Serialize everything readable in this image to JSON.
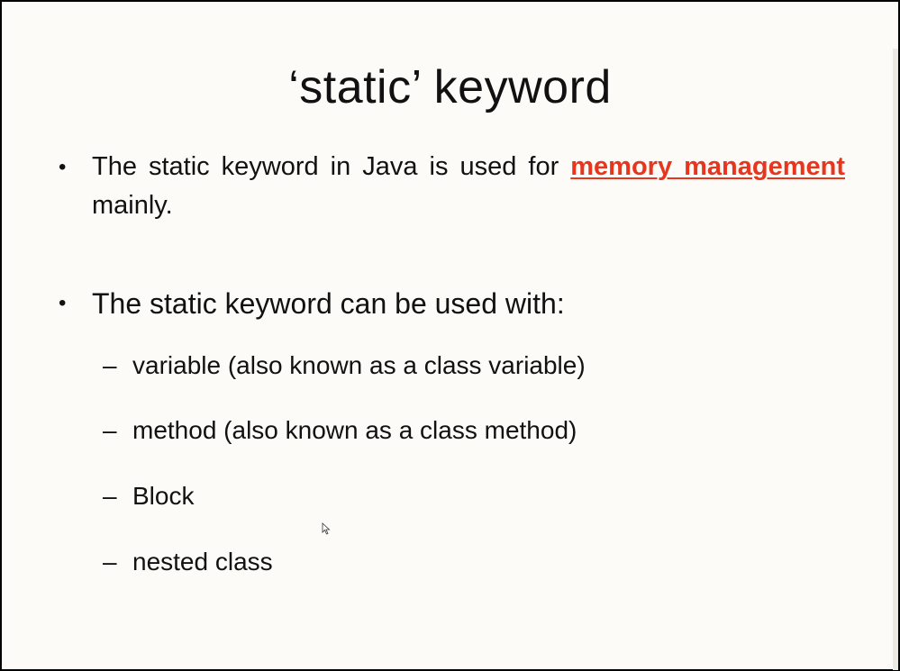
{
  "slide": {
    "title": "‘static’ keyword",
    "bullet1": {
      "marker": "•",
      "text_before": "The static keyword in Java is used for ",
      "highlight": "memory management",
      "text_after": " mainly."
    },
    "bullet2": {
      "marker": "•",
      "text": "The static keyword can be used with:"
    },
    "sub_items": [
      {
        "dash": "–",
        "text": "variable (also known as a class variable)"
      },
      {
        "dash": "–",
        "text": "method (also known as a class method)"
      },
      {
        "dash": "–",
        "text": "Block"
      },
      {
        "dash": "–",
        "text": "nested class"
      }
    ]
  },
  "colors": {
    "background": "#fcfbf8",
    "text": "#111111",
    "highlight": "#e8361e",
    "frame": "#000000"
  },
  "icons": {
    "cursor": "mouse-pointer-icon"
  }
}
